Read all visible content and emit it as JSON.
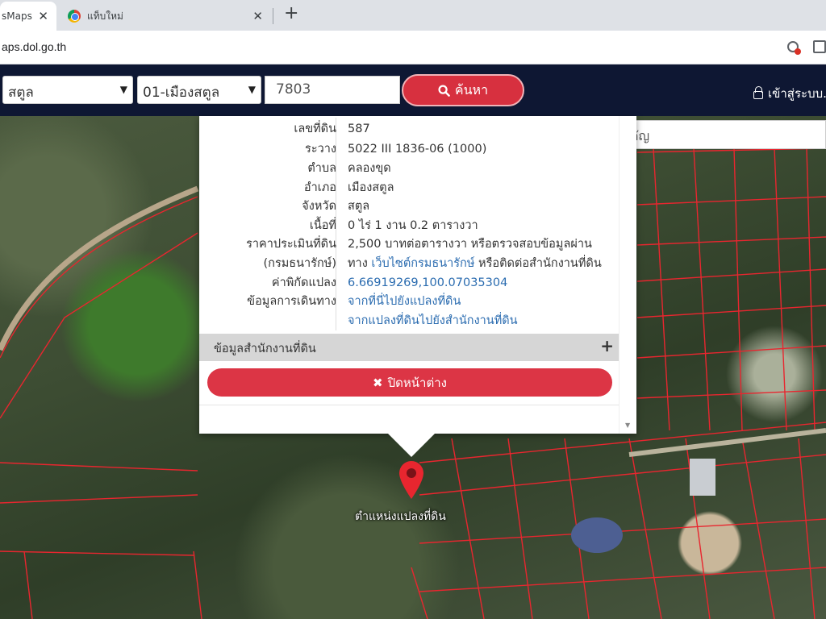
{
  "browser": {
    "tabs": [
      {
        "title": "sMaps",
        "active": true
      },
      {
        "title": "แท็บใหม่",
        "active": false
      }
    ],
    "close_glyph": "✕",
    "new_tab_glyph": "+",
    "url": "aps.dol.go.th"
  },
  "header": {
    "province": "สตูล",
    "district": "01-เมืองสตูล",
    "parcel_number": "7803",
    "search_label": "ค้นหา",
    "login_label": "เข้าสู่ระบบ..."
  },
  "map": {
    "place_search_placeholder": "ค้นหาสถานที่สำคัญ",
    "marker_label": "ตำแหน่งแปลงที่ดิน"
  },
  "popup": {
    "rows": [
      {
        "key": "เลขที่ดิน",
        "value": "587"
      },
      {
        "key": "ระวาง",
        "value": "5022 III 1836-06 (1000)"
      },
      {
        "key": "ตำบล",
        "value": "คลองขุด"
      },
      {
        "key": "อำเภอ",
        "value": "เมืองสตูล"
      },
      {
        "key": "จังหวัด",
        "value": "สตูล"
      },
      {
        "key": "เนื้อที่",
        "value": "0 ไร่ 1 งาน 0.2 ตารางวา"
      },
      {
        "key": "ราคาประเมินที่ดิน",
        "value": "2,500 บาทต่อตารางวา หรือตรวจสอบข้อมูลผ่าน"
      },
      {
        "key": "(กรมธนารักษ์)",
        "value_prefix": "ทาง ",
        "value_link": "เว็บไซต์กรมธนารักษ์",
        "value_suffix": " หรือติดต่อสำนักงานที่ดิน"
      },
      {
        "key": "ค่าพิกัดแปลง",
        "value": "6.66919269,100.07035304"
      },
      {
        "key": "ข้อมูลการเดินทาง",
        "value": "จากที่นี่ไปยังแปลงที่ดิน"
      },
      {
        "key": "",
        "value": "จากแปลงที่ดินไปยังสำนักงานที่ดิน"
      }
    ],
    "office_section": "ข้อมูลสำนักงานที่ดิน",
    "close_label": "ปิดหน้าต่าง"
  },
  "colors": {
    "header_bg": "#0e1733",
    "accent_red": "#d7303f",
    "link_blue": "#2b6cb0",
    "parcel_line": "#e8262f"
  }
}
